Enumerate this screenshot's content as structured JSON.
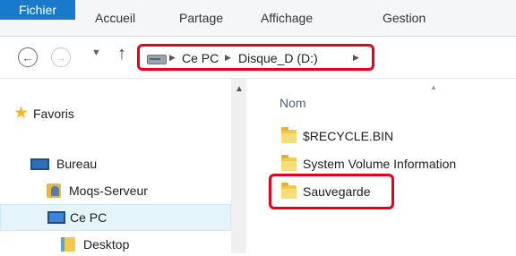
{
  "ribbon": {
    "tabs": [
      "Fichier",
      "Accueil",
      "Partage",
      "Affichage",
      "Gestion"
    ],
    "active_tab": "Fichier",
    "accent_color": "#1979ca"
  },
  "navigation": {
    "back_icon": "back-arrow-icon",
    "forward_icon": "forward-arrow-icon",
    "recent_icon": "chevron-down-icon",
    "up_icon": "up-arrow-icon"
  },
  "address": {
    "drive_icon": "drive-icon",
    "crumbs": [
      "Ce PC",
      "Disque_D (D:)"
    ],
    "highlight_color": "#e8001c"
  },
  "sidebar": {
    "items": [
      {
        "label": "Favoris",
        "icon": "star-icon"
      },
      {
        "label": "Bureau",
        "icon": "monitor-icon"
      },
      {
        "label": "Moqs-Serveur",
        "icon": "user-folder-icon"
      },
      {
        "label": "Ce PC",
        "icon": "computer-icon",
        "selected": true
      },
      {
        "label": "Desktop",
        "icon": "desktop-folder-icon"
      }
    ]
  },
  "content": {
    "column_header": "Nom",
    "files": [
      {
        "name": "$RECYCLE.BIN",
        "icon": "folder-icon"
      },
      {
        "name": "System Volume Information",
        "icon": "folder-icon"
      },
      {
        "name": "Sauvegarde",
        "icon": "folder-icon",
        "highlighted": true
      }
    ]
  }
}
